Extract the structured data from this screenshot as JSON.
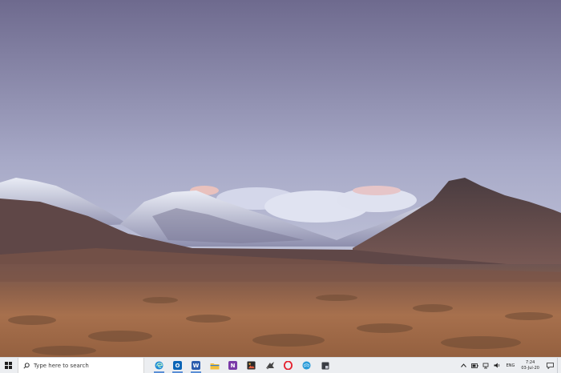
{
  "taskbar": {
    "search": {
      "placeholder": "Type here to search"
    },
    "pinned_apps": [
      {
        "name": "Microsoft Edge",
        "icon": "edge-icon",
        "color": "#1f8bd8",
        "open": true
      },
      {
        "name": "Outlook",
        "icon": "outlook-icon",
        "color": "#0a64b6",
        "glyph": "O",
        "open": true
      },
      {
        "name": "Word",
        "icon": "word-icon",
        "color": "#2b5cad",
        "glyph": "W",
        "open": true
      },
      {
        "name": "File Explorer",
        "icon": "folder-icon",
        "color": "#f3c03b",
        "open": false
      },
      {
        "name": "OneNote",
        "icon": "onenote-icon",
        "color": "#7a3aa8",
        "glyph": "N",
        "open": false
      },
      {
        "name": "Photos",
        "icon": "photos-icon",
        "color": "#2a2a2a",
        "open": false
      },
      {
        "name": "Snip tool",
        "icon": "snip-icon",
        "color": "#444444",
        "open": false
      },
      {
        "name": "Opera",
        "icon": "opera-icon",
        "color": "#e5202e",
        "glyph": "O",
        "open": false
      },
      {
        "name": "Browser",
        "icon": "globe-icon",
        "color": "#2a9bd8",
        "open": false
      },
      {
        "name": "Sticky app",
        "icon": "app-icon",
        "color": "#3a3d44",
        "open": false
      }
    ],
    "tray": {
      "language": "ENG",
      "time": "7:24",
      "date": "03-Jul-20"
    }
  }
}
